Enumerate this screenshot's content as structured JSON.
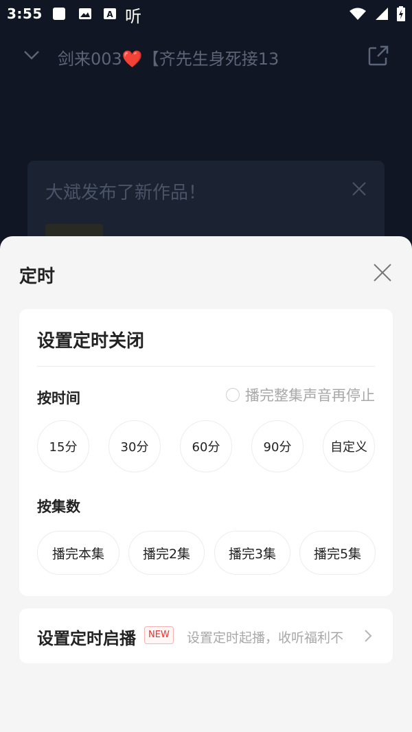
{
  "status_bar": {
    "time": "3:55",
    "notif_text_icon": "听"
  },
  "header": {
    "title": "剑来003❤️【齐先生身死接13"
  },
  "notice": {
    "title": "大斌发布了新作品！"
  },
  "sheet": {
    "title": "定时",
    "card": {
      "title": "设置定时关闭",
      "by_time_label": "按时间",
      "finish_episode_option": "播完整集声音再停止",
      "time_options": [
        "15分",
        "30分",
        "60分",
        "90分",
        "自定义"
      ],
      "by_episode_label": "按集数",
      "episode_options": [
        "播完本集",
        "播完2集",
        "播完3集",
        "播完5集"
      ]
    },
    "schedule_start": {
      "title": "设置定时启播",
      "badge": "NEW",
      "subtitle": "设置定时起播，收听福利不"
    }
  },
  "colors": {
    "accent_red": "#e8322e",
    "sheet_bg": "#f5f5f5",
    "dim_bg": "#101624"
  }
}
